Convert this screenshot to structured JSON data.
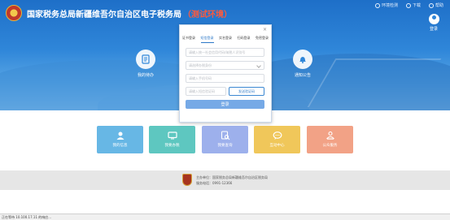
{
  "header": {
    "title": "国家税务总局新疆维吾尔自治区电子税务局",
    "tag": "（测试环境）",
    "links": [
      {
        "label": "环境检测",
        "icon": "monitor-icon"
      },
      {
        "label": "下载",
        "icon": "download-icon"
      },
      {
        "label": "帮助",
        "icon": "help-icon"
      }
    ],
    "login_label": "登录"
  },
  "hero": {
    "left_item": {
      "label": "我的待办",
      "icon": "todo-list-icon"
    },
    "right_item": {
      "label": "通知公告",
      "icon": "bell-icon"
    }
  },
  "login_modal": {
    "close": "×",
    "tabs": [
      "证书登录",
      "短信登录",
      "实名登录",
      "扫码登录",
      "免密登录"
    ],
    "active_tab": 1,
    "fields": {
      "taxpayer_id_placeholder": "请输入统一社会信用代码/纳税人识别号",
      "identity_placeholder": "请选择办税身份",
      "phone_placeholder": "请输入手机号码",
      "sms_code_placeholder": "请输入短信验证码"
    },
    "sms_button": "发送验证码",
    "login_button": "登录"
  },
  "services": [
    {
      "label": "我的信息",
      "icon": "user-icon",
      "color": "#67b7e5"
    },
    {
      "label": "我要办税",
      "icon": "computer-icon",
      "color": "#5ec7c0"
    },
    {
      "label": "我要查询",
      "icon": "search-doc-icon",
      "color": "#9db0ec"
    },
    {
      "label": "互动中心",
      "icon": "chat-icon",
      "color": "#f0c75a"
    },
    {
      "label": "公众服务",
      "icon": "people-service-icon",
      "color": "#f2a286"
    }
  ],
  "footer": {
    "host_line": "主办单位：国家税务总局新疆维吾尔自治区税务局",
    "phone_line": "服务电话：0991-12366"
  },
  "status_bar": {
    "text": "正在等待 10.100.17.11 的响应..."
  }
}
